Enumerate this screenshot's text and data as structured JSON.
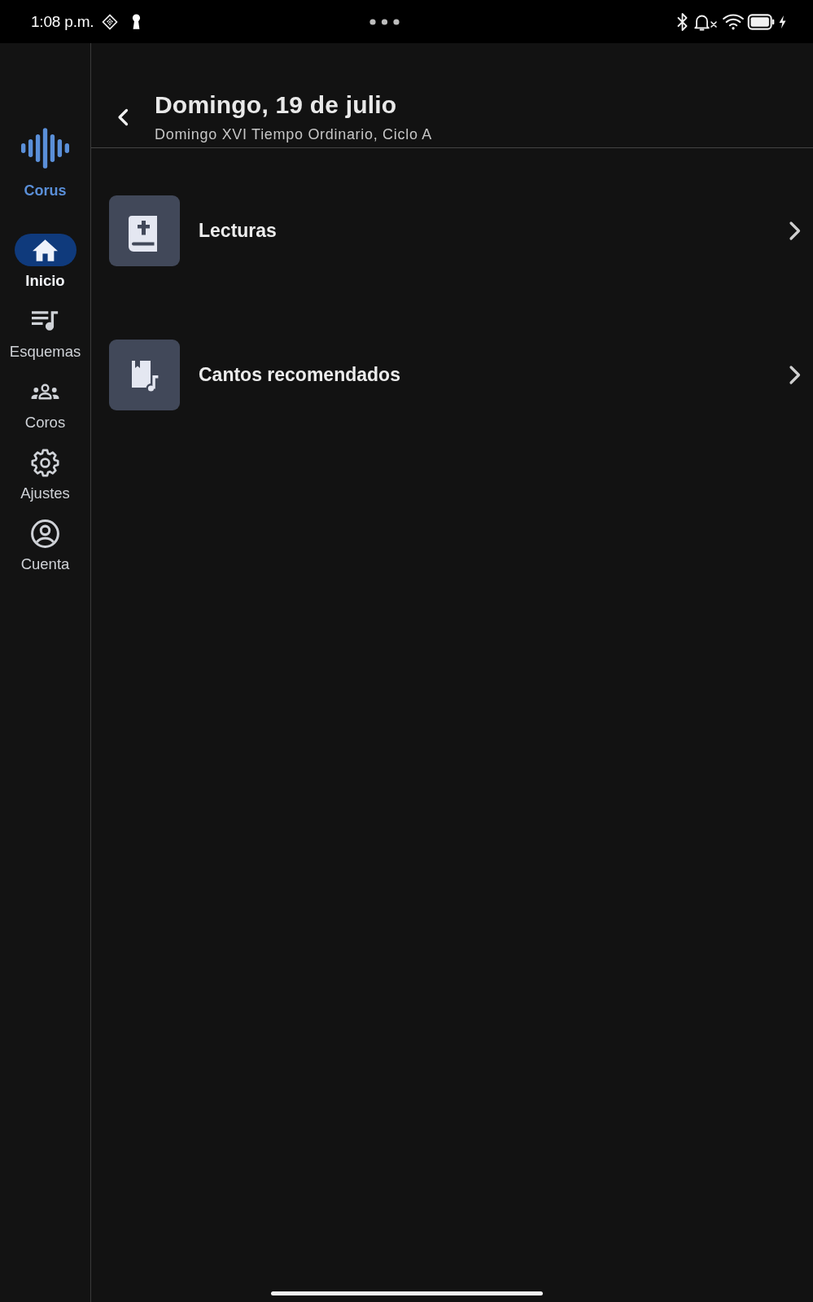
{
  "status_bar": {
    "time": "1:08 p.m."
  },
  "app": {
    "name": "Corus"
  },
  "nav": [
    {
      "label": "Inicio",
      "selected": true
    },
    {
      "label": "Esquemas",
      "selected": false
    },
    {
      "label": "Coros",
      "selected": false
    },
    {
      "label": "Ajustes",
      "selected": false
    },
    {
      "label": "Cuenta",
      "selected": false
    }
  ],
  "header": {
    "title": "Domingo, 19 de julio",
    "subtitle": "Domingo XVI Tiempo Ordinario, Ciclo A"
  },
  "items": [
    {
      "label": "Lecturas"
    },
    {
      "label": "Cantos recomendados"
    }
  ]
}
